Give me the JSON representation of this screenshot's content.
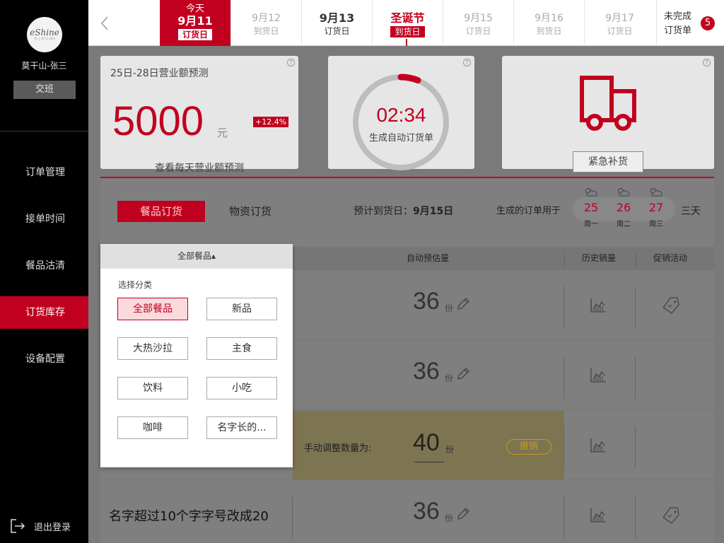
{
  "sidebar": {
    "logo_text": "eShine",
    "logo_sub": "圣 小 时 乐 eShi",
    "store_name": "莫干山-张三",
    "handover_label": "交班",
    "items": [
      {
        "label": "订单管理"
      },
      {
        "label": "接单时间"
      },
      {
        "label": "餐品沽清"
      },
      {
        "label": "订货库存"
      },
      {
        "label": "设备配置"
      }
    ],
    "active_index": 3,
    "logout_label": "退出登录"
  },
  "datebar": {
    "today": {
      "top": "今天",
      "date": "9月11",
      "sub": "订货日"
    },
    "cells": [
      {
        "date": "9月12",
        "sub": "到货日"
      },
      {
        "date": "9月13",
        "sub": "订货日"
      },
      {
        "date": "圣诞节",
        "sub": "到货日"
      },
      {
        "date": "9月15",
        "sub": "订货日"
      },
      {
        "date": "9月16",
        "sub": "到货日"
      },
      {
        "date": "9月17",
        "sub": "订货日"
      }
    ],
    "unfinished_label": "未完成订货单",
    "unfinished_count": "5"
  },
  "forecast": {
    "title": "25日-28日营业额预测",
    "value": "5000",
    "unit": "元",
    "change": "+12.4%",
    "link": "查看每天营业额预测"
  },
  "timer": {
    "time": "02:34",
    "label": "生成自动订货单"
  },
  "urgent": {
    "button_label": "紧急补货"
  },
  "order": {
    "tab_food": "餐品订货",
    "tab_supply": "物资订货",
    "expected_label": "预计到货日：",
    "expected_date": "9月15日",
    "generated_for": "生成的订单用于",
    "days": [
      {
        "num": "25",
        "weekday": "周一"
      },
      {
        "num": "26",
        "weekday": "周二"
      },
      {
        "num": "27",
        "weekday": "周三"
      }
    ],
    "three_days": "三天"
  },
  "table": {
    "headers": {
      "category": "全部餐品▴",
      "auto": "自动预估量",
      "history": "历史销量",
      "promo": "促销活动"
    },
    "rows": [
      {
        "qty": "36",
        "unit": "份"
      },
      {
        "qty": "36",
        "unit": "份"
      },
      {
        "manual_label": "手动调整数量为:",
        "qty": "40",
        "unit": "份",
        "undo": "撤销"
      },
      {
        "name": "名字超过10个字字号改成20",
        "qty": "36",
        "unit": "份"
      }
    ]
  },
  "dropdown": {
    "caption": "选择分类",
    "options": [
      "全部餐品",
      "新品",
      "大热沙拉",
      "主食",
      "饮料",
      "小吃",
      "咖啡",
      "名字长的..."
    ],
    "selected": "全部餐品"
  },
  "colors": {
    "accent": "#c1001f",
    "warning": "#c59a1c"
  }
}
